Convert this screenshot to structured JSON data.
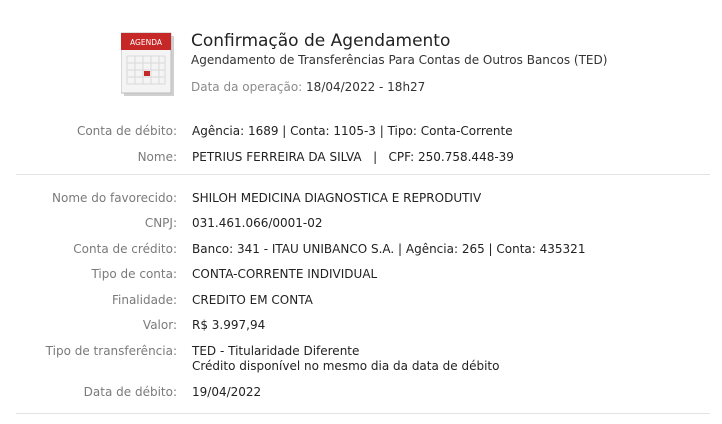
{
  "header": {
    "icon_label": "AGENDA",
    "title": "Confirmação de Agendamento",
    "subtitle": "Agendamento de Transferências Para Contas de Outros Bancos (TED)",
    "date_label": "Data da operação:",
    "date_value": "18/04/2022 - 18h27"
  },
  "debit": {
    "account_label": "Conta de débito:",
    "account_value": "Agência: 1689 | Conta: 1105-3 | Tipo: Conta-Corrente",
    "name_label": "Nome:",
    "name_value": "PETRIUS FERREIRA DA SILVA   |   CPF: 250.758.448-39"
  },
  "details": {
    "favorecido_label": "Nome do favorecido:",
    "favorecido_value": "SHILOH MEDICINA DIAGNOSTICA E REPRODUTIV",
    "cnpj_label": "CNPJ:",
    "cnpj_value": "031.461.066/0001-02",
    "credit_label": "Conta de crédito:",
    "credit_value": "Banco: 341 - ITAU UNIBANCO S.A. | Agência: 265 | Conta: 435321",
    "account_type_label": "Tipo de conta:",
    "account_type_value": "CONTA-CORRENTE INDIVIDUAL",
    "purpose_label": "Finalidade:",
    "purpose_value": "CREDITO EM CONTA",
    "amount_label": "Valor:",
    "amount_value": "R$ 3.997,94",
    "transfer_type_label": "Tipo de transferência:",
    "transfer_type_value": "TED - Titularidade Diferente",
    "transfer_type_note": "Crédito disponível no mesmo dia da data de débito",
    "debit_date_label": "Data de débito:",
    "debit_date_value": "19/04/2022"
  },
  "colors": {
    "icon_red": "#c62828",
    "label_gray": "#7a7a7a",
    "divider": "#e3e3e3"
  }
}
